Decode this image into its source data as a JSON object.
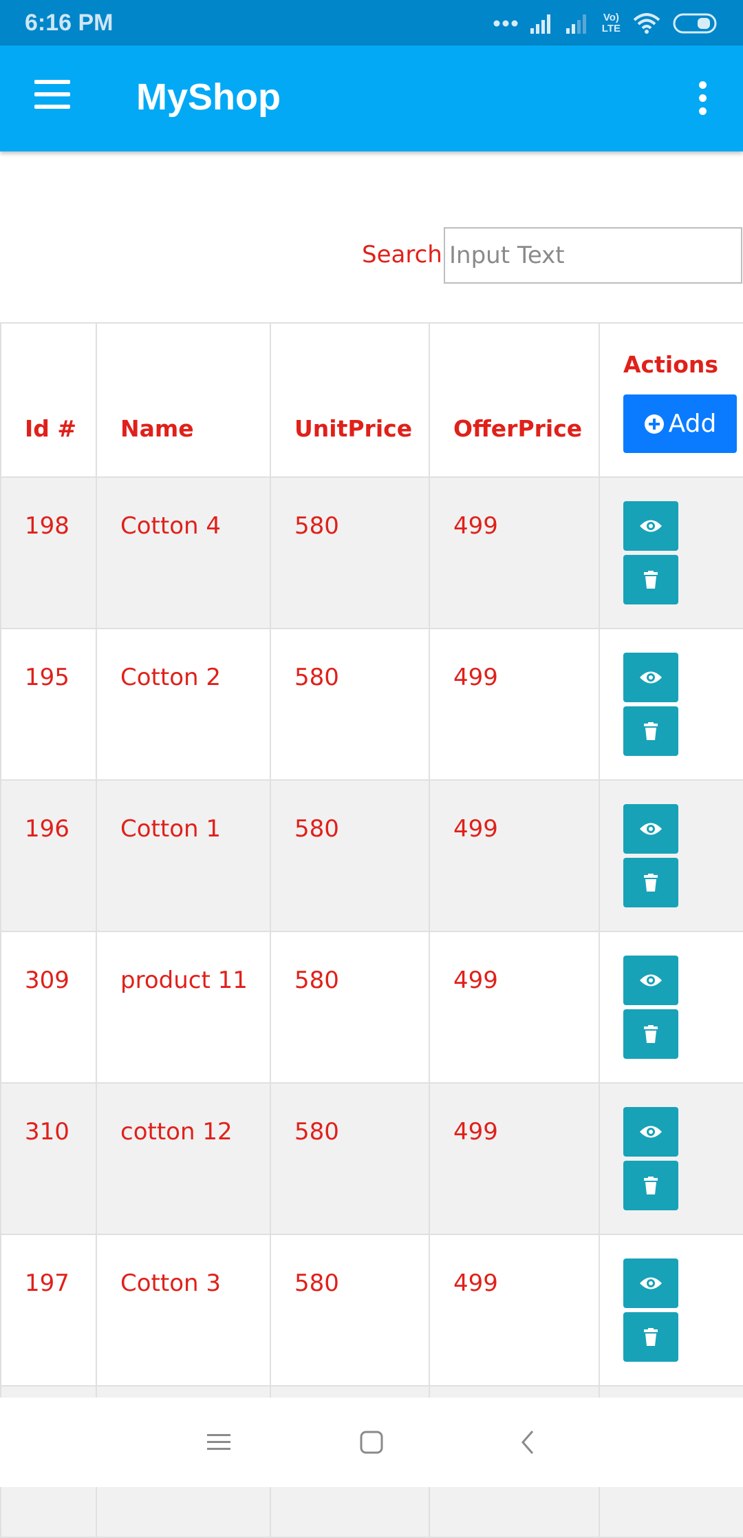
{
  "status_bar": {
    "time": "6:16 PM",
    "volte_top": "Vo)",
    "volte_bottom": "LTE"
  },
  "app_bar": {
    "title": "MyShop",
    "menu_icon": "hamburger-menu-icon",
    "overflow_icon": "more-vertical-icon",
    "background": "#03a9f4"
  },
  "search": {
    "label": "Search",
    "placeholder": "Input Text",
    "value": ""
  },
  "table": {
    "headers": {
      "id": "Id #",
      "name": "Name",
      "unit_price": "UnitPrice",
      "offer_price": "OfferPrice",
      "actions": "Actions"
    },
    "add_label": "Add",
    "add_icon": "plus-circle-icon",
    "view_icon": "eye-icon",
    "delete_icon": "trash-icon",
    "rows": [
      {
        "id": "198",
        "name": "Cotton 4",
        "unit_price": "580",
        "offer_price": "499"
      },
      {
        "id": "195",
        "name": "Cotton 2",
        "unit_price": "580",
        "offer_price": "499"
      },
      {
        "id": "196",
        "name": "Cotton 1",
        "unit_price": "580",
        "offer_price": "499"
      },
      {
        "id": "309",
        "name": "product 11",
        "unit_price": "580",
        "offer_price": "499"
      },
      {
        "id": "310",
        "name": "cotton 12",
        "unit_price": "580",
        "offer_price": "499"
      },
      {
        "id": "197",
        "name": "Cotton 3",
        "unit_price": "580",
        "offer_price": "499"
      },
      {
        "id": "",
        "name": "",
        "unit_price": "",
        "offer_price": ""
      }
    ]
  },
  "colors": {
    "text_red": "#e0201a",
    "add_blue": "#0a7bff",
    "action_teal": "#17a2b8",
    "status_bar": "#0086c9"
  },
  "nav_bar": {
    "recents_icon": "recents-menu-icon",
    "home_icon": "home-square-icon",
    "back_icon": "back-chevron-icon"
  }
}
